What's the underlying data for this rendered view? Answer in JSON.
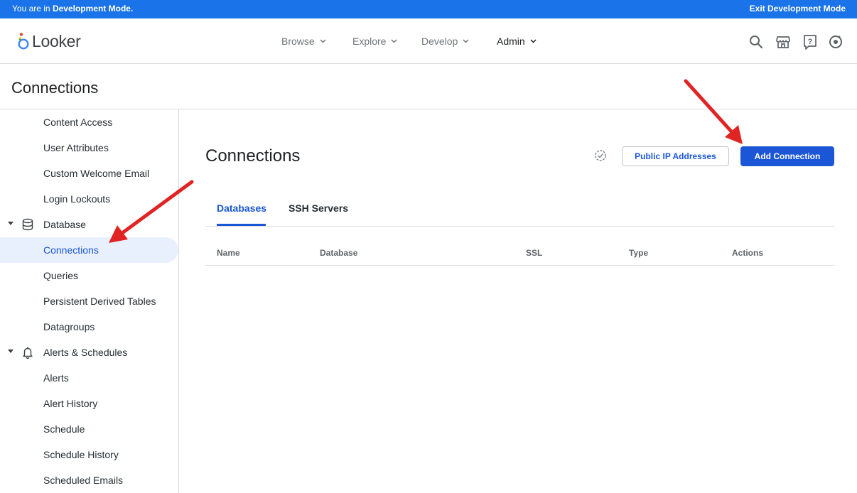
{
  "banner": {
    "prefix": "You are in ",
    "mode": "Development Mode.",
    "exit": "Exit Development Mode",
    "color": "#1a73e8"
  },
  "app": {
    "name": "Looker"
  },
  "nav": [
    {
      "label": "Browse",
      "active": false
    },
    {
      "label": "Explore",
      "active": false
    },
    {
      "label": "Develop",
      "active": false
    },
    {
      "label": "Admin",
      "active": true
    }
  ],
  "toolbar_icons": [
    "search-icon",
    "marketplace-icon",
    "help-icon",
    "account-icon"
  ],
  "page": {
    "title": "Connections"
  },
  "sidebar": {
    "items": [
      {
        "label": "Content Access"
      },
      {
        "label": "User Attributes"
      },
      {
        "label": "Custom Welcome Email"
      },
      {
        "label": "Login Lockouts"
      },
      {
        "label": "Database",
        "group": true,
        "icon": "database-icon"
      },
      {
        "label": "Connections",
        "selected": true
      },
      {
        "label": "Queries"
      },
      {
        "label": "Persistent Derived Tables"
      },
      {
        "label": "Datagroups"
      },
      {
        "label": "Alerts & Schedules",
        "group": true,
        "icon": "bell-icon"
      },
      {
        "label": "Alerts"
      },
      {
        "label": "Alert History"
      },
      {
        "label": "Schedule"
      },
      {
        "label": "Schedule History"
      },
      {
        "label": "Scheduled Emails"
      }
    ]
  },
  "main": {
    "title": "Connections",
    "buttons": {
      "public_ip": "Public IP Addresses",
      "add_connection": "Add Connection"
    },
    "tabs": [
      {
        "label": "Databases",
        "active": true
      },
      {
        "label": "SSH Servers",
        "active": false
      }
    ],
    "columns": [
      "Name",
      "Database",
      "SSL",
      "Type",
      "Actions"
    ]
  },
  "colors": {
    "accent": "#1a56d6",
    "annotation": "#e02424"
  }
}
